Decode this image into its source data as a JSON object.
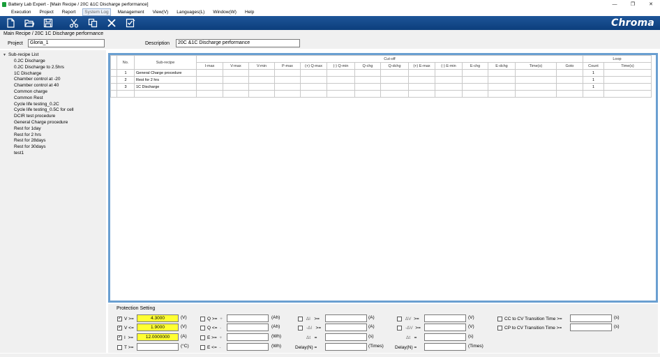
{
  "window": {
    "title": "Battery Lab Expert - [Main Recipe / 20C &1C Discharge performance]",
    "controls": [
      "—",
      "❐",
      "✕"
    ]
  },
  "menu": [
    "Execution",
    "Project",
    "Report",
    "System Log",
    "Management",
    "View(V)",
    "Languages(L)",
    "Window(W)",
    "Help"
  ],
  "toolbar": {
    "icons": [
      "new-file-icon",
      "open-folder-icon",
      "save-icon",
      "cut-icon",
      "copy-icon",
      "delete-icon",
      "checklist-icon"
    ],
    "brand": "Chroma"
  },
  "header": {
    "breadcrumb": "Main Recipe / 20C 1C Discharge performance",
    "project_label": "Project",
    "project_value": "Gloria_1",
    "description_label": "Description",
    "description_value": "20C &1C Discharge performance"
  },
  "sidebar": {
    "root": "Sub-recipe List",
    "items": [
      "0.2C Discharge",
      "0.2C Discharge to 2.5hrs",
      "1C Discharge",
      "Chamber control at -20",
      "Chamber control at 40",
      "Common charge",
      "Common Rest",
      "Cycle life testing_0.2C",
      "Cycle life testing_0.5C for cell",
      "DCIR test procedure",
      "General Charge procedure",
      "Rest for 1day",
      "Rest for 2 hrs",
      "Rest for 28days",
      "Rest for 30days",
      "test1"
    ]
  },
  "grid": {
    "group_headers": {
      "no": "No.",
      "subrecipe": "Sub-recipe",
      "cutoff": "Cut-off",
      "loop": "Loop"
    },
    "cutoff_columns": [
      "I-max",
      "V-max",
      "V-min",
      "P-max",
      "(+) Q-max",
      "(-) Q-min",
      "Q-chg",
      "Q-dchg",
      "(+) E-max",
      "(-) E-min",
      "E-chg",
      "E-dchg",
      "Time(s)",
      "Goto"
    ],
    "loop_columns": [
      "Count",
      "Time(s)"
    ],
    "rows": [
      {
        "no": "1",
        "subrecipe": "General Charge procedure",
        "count": "1"
      },
      {
        "no": "2",
        "subrecipe": "Rest for 2 hrs",
        "count": "1"
      },
      {
        "no": "3",
        "subrecipe": "1C Discharge",
        "count": "1"
      }
    ]
  },
  "protection": {
    "title": "Protection Setting",
    "rows": [
      {
        "c1": {
          "checked": true,
          "label": "V",
          "op": ">=",
          "value": "4.3000",
          "unit": "(V)"
        },
        "c2": {
          "checked": false,
          "label": "Q",
          "op": ">=",
          "sign": "+",
          "value": "",
          "unit": "(Ah)"
        },
        "c3": {
          "checked": false,
          "label": "ΔI",
          "op": ">=",
          "value": "",
          "unit": "(A)"
        },
        "c4": {
          "checked": false,
          "label": "ΔV",
          "op": ">=",
          "value": "",
          "unit": "(V)"
        },
        "c5": {
          "checked": false,
          "label": "CC to CV Transition Time",
          "op": ">=",
          "value": "",
          "unit": "(s)"
        }
      },
      {
        "c1": {
          "checked": true,
          "label": "V",
          "op": "<=",
          "value": "1.9000",
          "unit": "(V)"
        },
        "c2": {
          "checked": false,
          "label": "Q",
          "op": "<=",
          "sign": "-",
          "value": "",
          "unit": "(Ah)"
        },
        "c3": {
          "checked": false,
          "label": "-ΔI",
          "op": ">=",
          "value": "",
          "unit": "(A)"
        },
        "c4": {
          "checked": false,
          "label": "-ΔV",
          "op": ">=",
          "value": "",
          "unit": "(V)"
        },
        "c5": {
          "checked": false,
          "label": "CP to CV Transition Time",
          "op": ">=",
          "value": "",
          "unit": "(s)"
        }
      },
      {
        "c1": {
          "checked": true,
          "label": "I",
          "op": ">=",
          "value": "12.0000000",
          "unit": "(A)"
        },
        "c2": {
          "checked": false,
          "label": "E",
          "op": ">=",
          "sign": "+",
          "value": "",
          "unit": "(Wh)"
        },
        "c3": {
          "label": "Δt",
          "op": "=",
          "value": "",
          "unit": "(s)"
        },
        "c4": {
          "label": "Δt",
          "op": "=",
          "value": "",
          "unit": "(s)"
        }
      },
      {
        "c1": {
          "checked": false,
          "label": "T",
          "op": ">=",
          "value": "",
          "unit": "(°C)"
        },
        "c2": {
          "checked": false,
          "label": "E",
          "op": "<=",
          "sign": "-",
          "value": "",
          "unit": "(Wh)"
        },
        "c3": {
          "label": "Delay(N)",
          "op": "=",
          "value": "",
          "unit": "(Times)"
        },
        "c4": {
          "label": "Delay(N)",
          "op": "=",
          "value": "",
          "unit": "(Times)"
        }
      }
    ]
  },
  "colors": {
    "toolbar": "#1e5598",
    "highlight": "#ffff33",
    "frame": "#6a9fd1"
  }
}
